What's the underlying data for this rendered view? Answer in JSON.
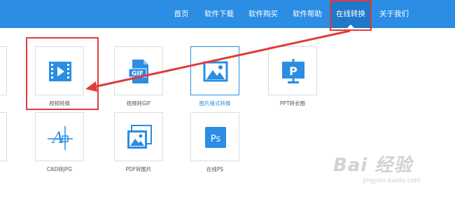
{
  "nav": {
    "items": [
      {
        "label": "首页"
      },
      {
        "label": "软件下载"
      },
      {
        "label": "软件购买"
      },
      {
        "label": "软件帮助"
      },
      {
        "label": "在线转换",
        "active": true
      },
      {
        "label": "关于我们"
      }
    ]
  },
  "tiles": [
    {
      "label": "视频转换",
      "icon": "video-icon"
    },
    {
      "label": "视频转GIF",
      "icon": "gif-file-icon",
      "badge": "GIF"
    },
    {
      "label": "图片格式转换",
      "icon": "image-icon",
      "selected": true
    },
    {
      "label": "PPT转长图",
      "icon": "ppt-icon",
      "badge": "P"
    },
    {
      "label": "CAD转JPG",
      "icon": "cad-icon",
      "badge": "A"
    },
    {
      "label": "PDF转图片",
      "icon": "pdf-image-icon"
    },
    {
      "label": "在线PS",
      "icon": "photoshop-icon",
      "badge": "Ps"
    }
  ],
  "watermark": {
    "logo": "Bai 经验",
    "url": "jingyan.baidu.com"
  },
  "colors": {
    "nav_bg": "#2b8de3",
    "nav_active_bg": "#1f78c9",
    "icon_blue": "#2b8de3",
    "annotation_red": "#e23b3b"
  }
}
